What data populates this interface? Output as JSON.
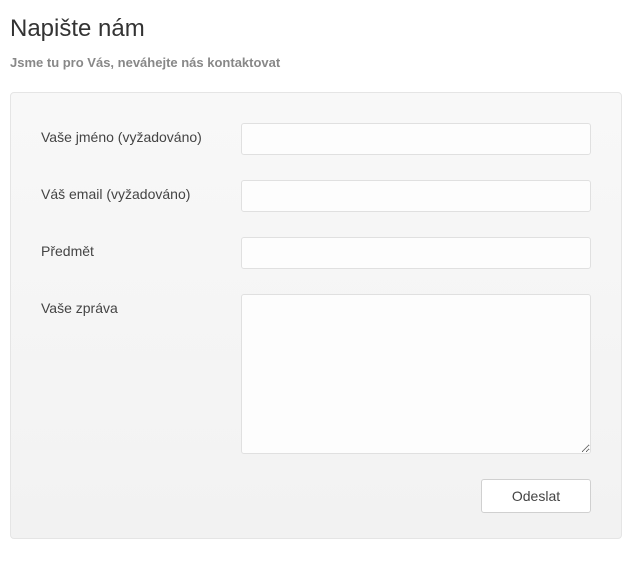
{
  "header": {
    "title": "Napište nám",
    "subtitle": "Jsme tu pro Vás, neváhejte nás kontaktovat"
  },
  "form": {
    "name_label": "Vaše jméno (vyžadováno)",
    "name_value": "",
    "email_label": "Váš email (vyžadováno)",
    "email_value": "",
    "subject_label": "Předmět",
    "subject_value": "",
    "message_label": "Vaše zpráva",
    "message_value": "",
    "submit_label": "Odeslat"
  }
}
